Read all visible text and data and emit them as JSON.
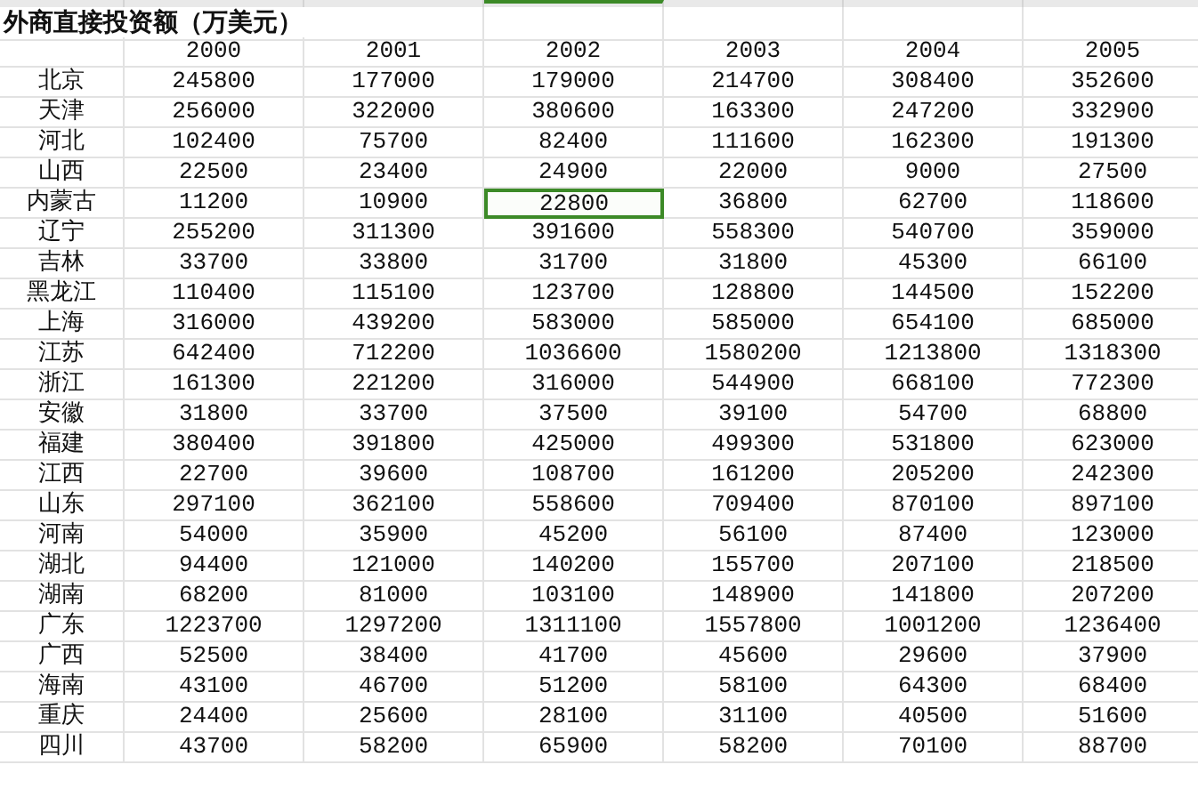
{
  "title": "外商直接投资额（万美元）",
  "columns": [
    "2000",
    "2001",
    "2002",
    "2003",
    "2004",
    "2005"
  ],
  "rows": [
    {
      "region": "北京",
      "values": [
        {
          "text": "245800",
          "selected": false
        },
        {
          "text": "177000",
          "selected": false
        },
        {
          "text": "179000",
          "selected": false
        },
        {
          "text": "214700",
          "selected": false
        },
        {
          "text": "308400",
          "selected": false
        },
        {
          "text": "352600",
          "selected": false
        }
      ]
    },
    {
      "region": "天津",
      "values": [
        {
          "text": "256000",
          "selected": false
        },
        {
          "text": "322000",
          "selected": false
        },
        {
          "text": "380600",
          "selected": false
        },
        {
          "text": "163300",
          "selected": false
        },
        {
          "text": "247200",
          "selected": false
        },
        {
          "text": "332900",
          "selected": false
        }
      ]
    },
    {
      "region": "河北",
      "values": [
        {
          "text": "102400",
          "selected": false
        },
        {
          "text": "75700",
          "selected": false
        },
        {
          "text": "82400",
          "selected": false
        },
        {
          "text": "111600",
          "selected": false
        },
        {
          "text": "162300",
          "selected": false
        },
        {
          "text": "191300",
          "selected": false
        }
      ]
    },
    {
      "region": "山西",
      "values": [
        {
          "text": "22500",
          "selected": false
        },
        {
          "text": "23400",
          "selected": false
        },
        {
          "text": "24900",
          "selected": false
        },
        {
          "text": "22000",
          "selected": false
        },
        {
          "text": "9000",
          "selected": false
        },
        {
          "text": "27500",
          "selected": false
        }
      ]
    },
    {
      "region": "内蒙古",
      "values": [
        {
          "text": "11200",
          "selected": false
        },
        {
          "text": "10900",
          "selected": false
        },
        {
          "text": "22800",
          "selected": true
        },
        {
          "text": "36800",
          "selected": false
        },
        {
          "text": "62700",
          "selected": false
        },
        {
          "text": "118600",
          "selected": false
        }
      ]
    },
    {
      "region": "辽宁",
      "values": [
        {
          "text": "255200",
          "selected": false
        },
        {
          "text": "311300",
          "selected": false
        },
        {
          "text": "391600",
          "selected": false
        },
        {
          "text": "558300",
          "selected": false
        },
        {
          "text": "540700",
          "selected": false
        },
        {
          "text": "359000",
          "selected": false
        }
      ]
    },
    {
      "region": "吉林",
      "values": [
        {
          "text": "33700",
          "selected": false
        },
        {
          "text": "33800",
          "selected": false
        },
        {
          "text": "31700",
          "selected": false
        },
        {
          "text": "31800",
          "selected": false
        },
        {
          "text": "45300",
          "selected": false
        },
        {
          "text": "66100",
          "selected": false
        }
      ]
    },
    {
      "region": "黑龙江",
      "values": [
        {
          "text": "110400",
          "selected": false
        },
        {
          "text": "115100",
          "selected": false
        },
        {
          "text": "123700",
          "selected": false
        },
        {
          "text": "128800",
          "selected": false
        },
        {
          "text": "144500",
          "selected": false
        },
        {
          "text": "152200",
          "selected": false
        }
      ]
    },
    {
      "region": "上海",
      "values": [
        {
          "text": "316000",
          "selected": false
        },
        {
          "text": "439200",
          "selected": false
        },
        {
          "text": "583000",
          "selected": false
        },
        {
          "text": "585000",
          "selected": false
        },
        {
          "text": "654100",
          "selected": false
        },
        {
          "text": "685000",
          "selected": false
        }
      ]
    },
    {
      "region": "江苏",
      "values": [
        {
          "text": "642400",
          "selected": false
        },
        {
          "text": "712200",
          "selected": false
        },
        {
          "text": "1036600",
          "selected": false
        },
        {
          "text": "1580200",
          "selected": false
        },
        {
          "text": "1213800",
          "selected": false
        },
        {
          "text": "1318300",
          "selected": false
        }
      ]
    },
    {
      "region": "浙江",
      "values": [
        {
          "text": "161300",
          "selected": false
        },
        {
          "text": "221200",
          "selected": false
        },
        {
          "text": "316000",
          "selected": false
        },
        {
          "text": "544900",
          "selected": false
        },
        {
          "text": "668100",
          "selected": false
        },
        {
          "text": "772300",
          "selected": false
        }
      ]
    },
    {
      "region": "安徽",
      "values": [
        {
          "text": "31800",
          "selected": false
        },
        {
          "text": "33700",
          "selected": false
        },
        {
          "text": "37500",
          "selected": false
        },
        {
          "text": "39100",
          "selected": false
        },
        {
          "text": "54700",
          "selected": false
        },
        {
          "text": "68800",
          "selected": false
        }
      ]
    },
    {
      "region": "福建",
      "values": [
        {
          "text": "380400",
          "selected": false
        },
        {
          "text": "391800",
          "selected": false
        },
        {
          "text": "425000",
          "selected": false
        },
        {
          "text": "499300",
          "selected": false
        },
        {
          "text": "531800",
          "selected": false
        },
        {
          "text": "623000",
          "selected": false
        }
      ]
    },
    {
      "region": "江西",
      "values": [
        {
          "text": "22700",
          "selected": false
        },
        {
          "text": "39600",
          "selected": false
        },
        {
          "text": "108700",
          "selected": false
        },
        {
          "text": "161200",
          "selected": false
        },
        {
          "text": "205200",
          "selected": false
        },
        {
          "text": "242300",
          "selected": false
        }
      ]
    },
    {
      "region": "山东",
      "values": [
        {
          "text": "297100",
          "selected": false
        },
        {
          "text": "362100",
          "selected": false
        },
        {
          "text": "558600",
          "selected": false
        },
        {
          "text": "709400",
          "selected": false
        },
        {
          "text": "870100",
          "selected": false
        },
        {
          "text": "897100",
          "selected": false
        }
      ]
    },
    {
      "region": "河南",
      "values": [
        {
          "text": "54000",
          "selected": false
        },
        {
          "text": "35900",
          "selected": false
        },
        {
          "text": "45200",
          "selected": false
        },
        {
          "text": "56100",
          "selected": false
        },
        {
          "text": "87400",
          "selected": false
        },
        {
          "text": "123000",
          "selected": false
        }
      ]
    },
    {
      "region": "湖北",
      "values": [
        {
          "text": "94400",
          "selected": false
        },
        {
          "text": "121000",
          "selected": false
        },
        {
          "text": "140200",
          "selected": false
        },
        {
          "text": "155700",
          "selected": false
        },
        {
          "text": "207100",
          "selected": false
        },
        {
          "text": "218500",
          "selected": false
        }
      ]
    },
    {
      "region": "湖南",
      "values": [
        {
          "text": "68200",
          "selected": false
        },
        {
          "text": "81000",
          "selected": false
        },
        {
          "text": "103100",
          "selected": false
        },
        {
          "text": "148900",
          "selected": false
        },
        {
          "text": "141800",
          "selected": false
        },
        {
          "text": "207200",
          "selected": false
        }
      ]
    },
    {
      "region": "广东",
      "values": [
        {
          "text": "1223700",
          "selected": false
        },
        {
          "text": "1297200",
          "selected": false
        },
        {
          "text": "1311100",
          "selected": false
        },
        {
          "text": "1557800",
          "selected": false
        },
        {
          "text": "1001200",
          "selected": false
        },
        {
          "text": "1236400",
          "selected": false
        }
      ]
    },
    {
      "region": "广西",
      "values": [
        {
          "text": "52500",
          "selected": false
        },
        {
          "text": "38400",
          "selected": false
        },
        {
          "text": "41700",
          "selected": false
        },
        {
          "text": "45600",
          "selected": false
        },
        {
          "text": "29600",
          "selected": false
        },
        {
          "text": "37900",
          "selected": false
        }
      ]
    },
    {
      "region": "海南",
      "values": [
        {
          "text": "43100",
          "selected": false
        },
        {
          "text": "46700",
          "selected": false
        },
        {
          "text": "51200",
          "selected": false
        },
        {
          "text": "58100",
          "selected": false
        },
        {
          "text": "64300",
          "selected": false
        },
        {
          "text": "68400",
          "selected": false
        }
      ]
    },
    {
      "region": "重庆",
      "values": [
        {
          "text": "24400",
          "selected": false
        },
        {
          "text": "25600",
          "selected": false
        },
        {
          "text": "28100",
          "selected": false
        },
        {
          "text": "31100",
          "selected": false
        },
        {
          "text": "40500",
          "selected": false
        },
        {
          "text": "51600",
          "selected": false
        }
      ]
    },
    {
      "region": "四川",
      "values": [
        {
          "text": "43700",
          "selected": false
        },
        {
          "text": "58200",
          "selected": false
        },
        {
          "text": "65900",
          "selected": false
        },
        {
          "text": "58200",
          "selected": false
        },
        {
          "text": "70100",
          "selected": false
        },
        {
          "text": "88700",
          "selected": false
        }
      ]
    }
  ]
}
